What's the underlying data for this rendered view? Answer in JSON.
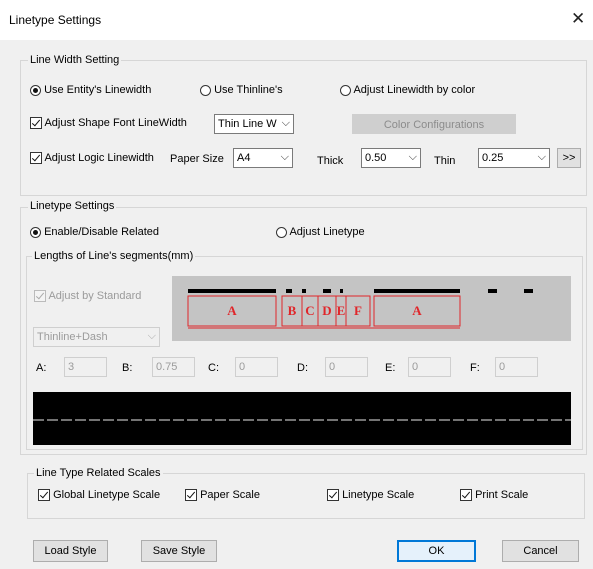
{
  "window": {
    "title": "Linetype Settings",
    "close_glyph": "✕"
  },
  "line_width": {
    "legend": "Line Width Setting",
    "radio_entity": "Use Entity's Linewidth",
    "radio_thinline": "Use Thinline's",
    "radio_by_color": "Adjust Linewidth by color",
    "selected": "entity",
    "adjust_shape_font": {
      "label": "Adjust Shape Font LineWidth",
      "checked": true
    },
    "shape_font_combo": "Thin Line W",
    "color_config_button": "Color Configurations",
    "adjust_logic": {
      "label": "Adjust Logic Linewidth",
      "checked": true
    },
    "paper_size_label": "Paper Size",
    "paper_size_value": "A4",
    "thick_label": "Thick",
    "thick_value": "0.50",
    "thin_label": "Thin",
    "thin_value": "0.25",
    "more_button": ">>"
  },
  "linetype": {
    "legend": "Linetype Settings",
    "radio_enable": "Enable/Disable Related",
    "radio_adjust": "Adjust Linetype",
    "selected": "enable",
    "segments_legend": "Lengths of Line's segments(mm)",
    "adjust_standard": {
      "label": "Adjust by Standard",
      "checked": true
    },
    "pattern_combo": "Thinline+Dash",
    "params": [
      {
        "label": "A:",
        "value": "3"
      },
      {
        "label": "B:",
        "value": "0.75"
      },
      {
        "label": "C:",
        "value": "0"
      },
      {
        "label": "D:",
        "value": "0"
      },
      {
        "label": "E:",
        "value": "0"
      },
      {
        "label": "F:",
        "value": "0"
      }
    ],
    "diagram_labels": [
      "A",
      "B",
      "C",
      "D",
      "E",
      "F",
      "A"
    ]
  },
  "scales": {
    "legend": "Line Type Related Scales",
    "global": {
      "label": "Global Linetype Scale",
      "checked": true
    },
    "paper": {
      "label": "Paper Scale",
      "checked": true
    },
    "linetype": {
      "label": "Linetype Scale",
      "checked": true
    },
    "print": {
      "label": "Print Scale",
      "checked": true
    }
  },
  "buttons": {
    "load": "Load Style",
    "save": "Save Style",
    "ok": "OK",
    "cancel": "Cancel"
  },
  "colors": {
    "diagram_red": "#e0262a",
    "diagram_bg": "#c4c4c4",
    "preview_bg": "#000000",
    "accent": "#0078d7"
  }
}
